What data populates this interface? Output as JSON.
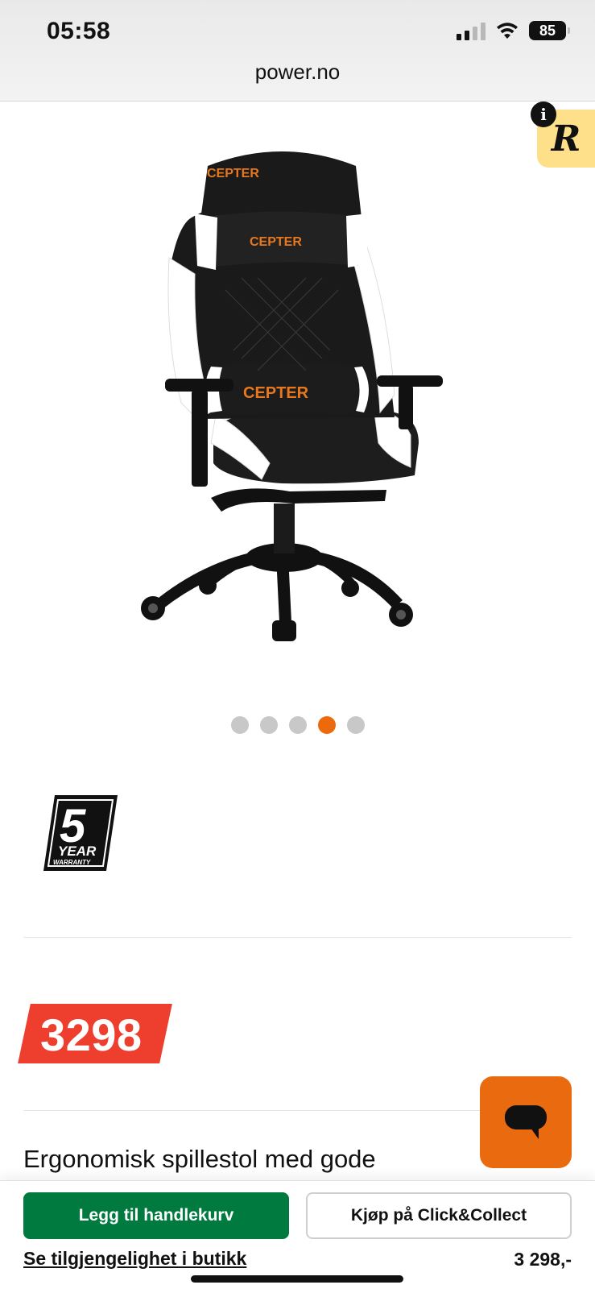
{
  "status_bar": {
    "time": "05:58",
    "battery": "85",
    "icons": [
      "cellular-signal-icon",
      "wifi-icon",
      "battery-icon"
    ]
  },
  "browser": {
    "url": "power.no"
  },
  "widget": {
    "letter": "R",
    "info": "i"
  },
  "product": {
    "image": {
      "description_icon": "gaming-chair-image",
      "brand_print": "CEPTER"
    },
    "carousel": {
      "total": 5,
      "active_index": 3
    },
    "warranty": {
      "number": "5",
      "line1": "YEAR",
      "line2": "WARRANTY"
    },
    "price": "3298",
    "title": "Ergonomisk spillestol med gode"
  },
  "actions": {
    "add_to_cart": "Legg til handlekurv",
    "click_collect": "Kjøp på Click&Collect",
    "availability": "Se tilgjengelighet i butikk",
    "price_summary": "3 298,-"
  },
  "colors": {
    "brand_orange": "#ec6a0c",
    "price_red": "#ee3f2e",
    "cart_green": "#007a3e",
    "widget_yellow": "#ffe08a"
  }
}
